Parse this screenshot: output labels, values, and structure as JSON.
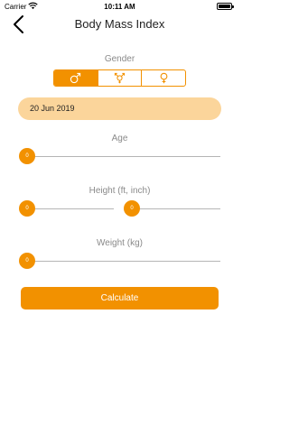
{
  "status_bar": {
    "carrier": "Carrier",
    "time": "10:11 AM"
  },
  "nav": {
    "title": "Body Mass Index",
    "back_icon": "chevron-left-icon"
  },
  "gender": {
    "label": "Gender",
    "options": [
      {
        "icon": "male-icon",
        "selected": true
      },
      {
        "icon": "transgender-icon",
        "selected": false
      },
      {
        "icon": "female-icon",
        "selected": false
      }
    ]
  },
  "date": {
    "value": "20 Jun 2019"
  },
  "age": {
    "label": "Age",
    "value": "0"
  },
  "height": {
    "label": "Height (ft, inch)",
    "feet_value": "0",
    "inch_value": "0"
  },
  "weight": {
    "label": "Weight (kg)",
    "value": "0"
  },
  "calculate_button": {
    "label": "Calculate"
  },
  "colors": {
    "accent": "#f29100",
    "accent_light": "#fbd59b",
    "track": "#b5b5b5"
  }
}
